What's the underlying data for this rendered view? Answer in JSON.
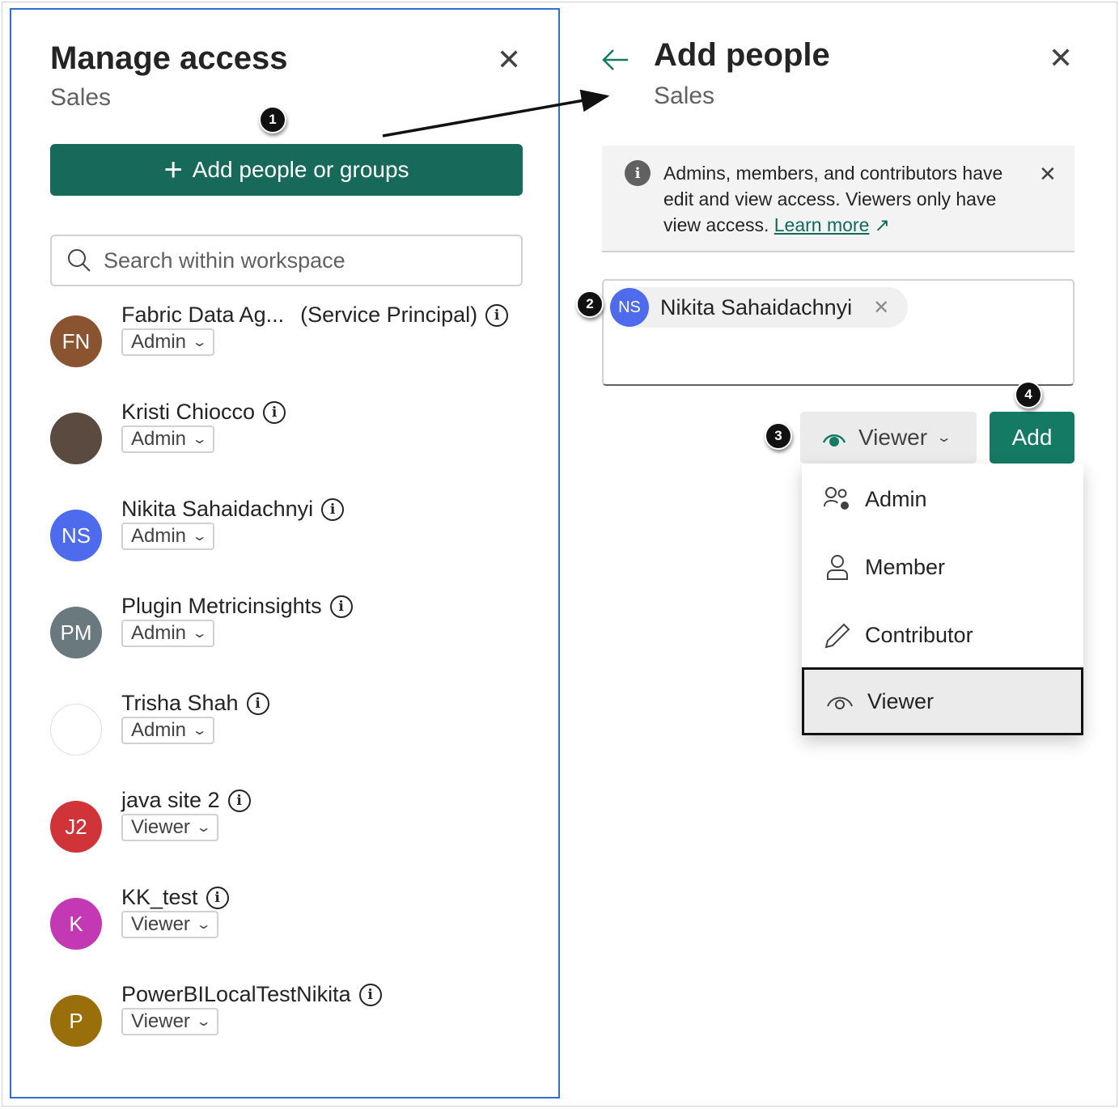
{
  "manage_access": {
    "title": "Manage access",
    "subtitle": "Sales",
    "add_button": "Add people or groups",
    "search_placeholder": "Search within workspace",
    "members": [
      {
        "initials": "FN",
        "name": "Fabric Data Ag...",
        "suffix": "(Service Principal)",
        "role": "Admin",
        "color": "#8a5430"
      },
      {
        "initials": "",
        "name": "Kristi Chiocco",
        "suffix": "",
        "role": "Admin",
        "color": "#5a4a40"
      },
      {
        "initials": "NS",
        "name": "Nikita Sahaidachnyi",
        "suffix": "",
        "role": "Admin",
        "color": "#4f6bed"
      },
      {
        "initials": "PM",
        "name": "Plugin Metricinsights",
        "suffix": "",
        "role": "Admin",
        "color": "#69797e"
      },
      {
        "initials": "",
        "name": "Trisha Shah",
        "suffix": "",
        "role": "Admin",
        "color": "#ffffff"
      },
      {
        "initials": "J2",
        "name": "java site 2",
        "suffix": "",
        "role": "Viewer",
        "color": "#d13438"
      },
      {
        "initials": "K",
        "name": "KK_test",
        "suffix": "",
        "role": "Viewer",
        "color": "#c239b3"
      },
      {
        "initials": "P",
        "name": "PowerBILocalTestNikita",
        "suffix": "",
        "role": "Viewer",
        "color": "#986f0b"
      }
    ]
  },
  "add_people": {
    "title": "Add people",
    "subtitle": "Sales",
    "banner_text": "Admins, members, and contributors have edit and view access. Viewers only have view access.",
    "banner_link": "Learn more",
    "chip_initials": "NS",
    "chip_name": "Nikita Sahaidachnyi",
    "role_selected": "Viewer",
    "add_label": "Add",
    "menu": [
      "Admin",
      "Member",
      "Contributor",
      "Viewer"
    ]
  },
  "steps": [
    "1",
    "2",
    "3",
    "4"
  ]
}
